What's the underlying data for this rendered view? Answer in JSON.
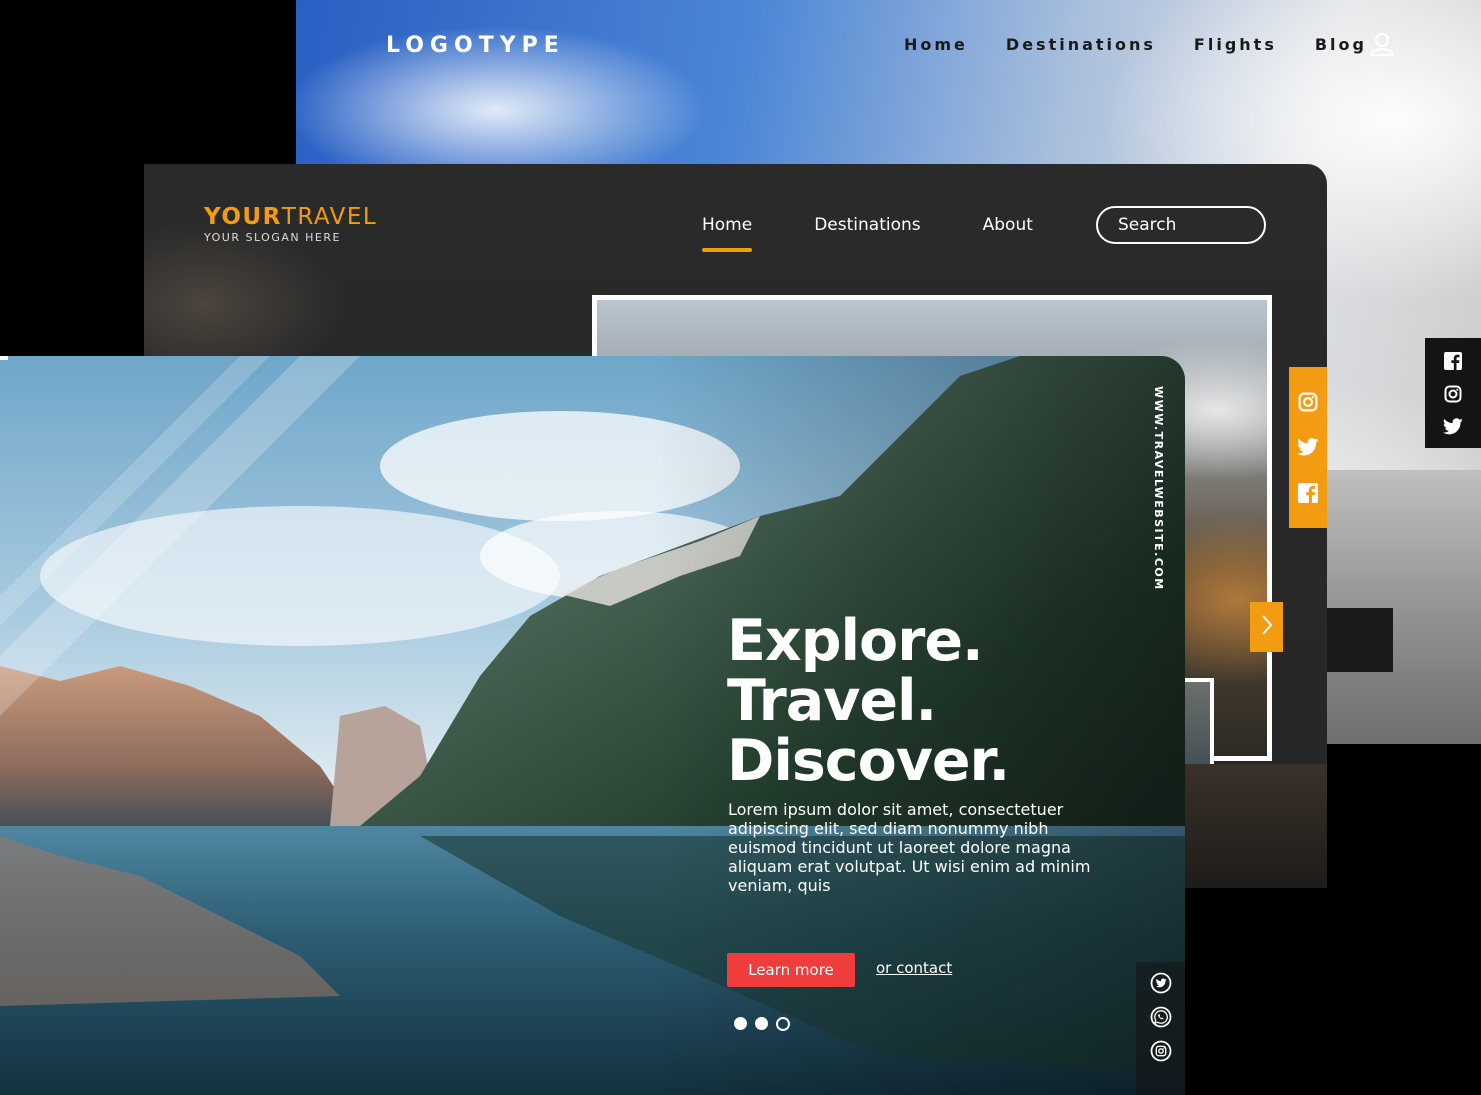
{
  "back_page": {
    "logo": "LOGOTYPE",
    "nav": [
      "Home",
      "Destinations",
      "Flights",
      "Blog"
    ],
    "user_icon": "user-icon",
    "social_icons": [
      "facebook-icon",
      "instagram-icon",
      "twitter-icon"
    ]
  },
  "mid_page": {
    "brand_bold": "YOUR",
    "brand_light": "TRAVEL",
    "slogan": "YOUR SLOGAN HERE",
    "nav": [
      "Home",
      "Destinations",
      "About"
    ],
    "active_nav": "Home",
    "search_placeholder": "Search",
    "social_icons": [
      "instagram-icon",
      "twitter-icon",
      "facebook-icon"
    ],
    "next_icon": "chevron-right-icon",
    "accent": "#f39c12"
  },
  "front_page": {
    "vertical_url": "WWW.TRAVELWEBSITE.COM",
    "headline": [
      "Explore.",
      "Travel.",
      "Discover."
    ],
    "body": "Lorem ipsum dolor sit amet, consectetuer adipiscing elit, sed diam nonummy nibh euismod tincidunt ut laoreet dolore magna aliquam erat volutpat. Ut wisi enim ad minim veniam, quis",
    "cta_label": "Learn more",
    "contact_link": "or contact",
    "cta_color": "#ef3d3d",
    "carousel": {
      "total": 3,
      "active": 3
    },
    "social_icons": [
      "twitter-icon",
      "whatsapp-icon",
      "instagram-icon"
    ]
  }
}
